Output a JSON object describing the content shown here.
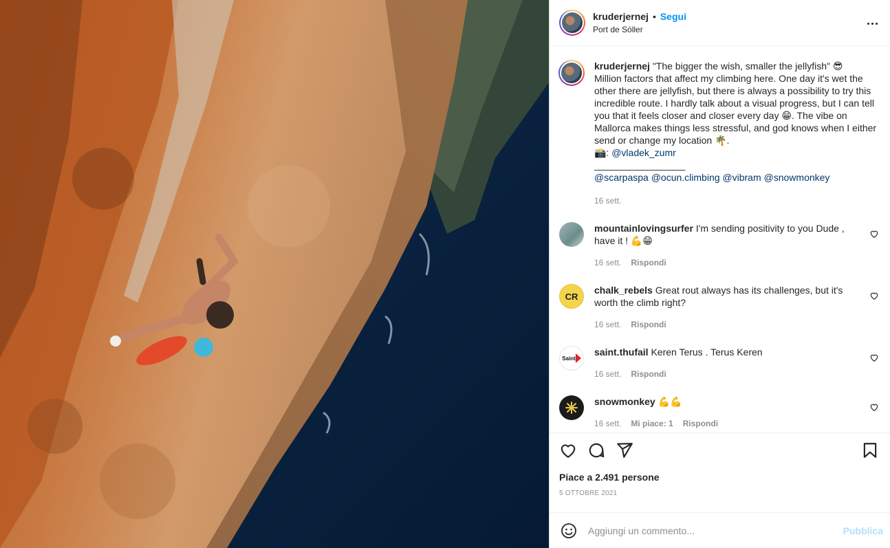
{
  "header": {
    "username": "kruderjernej",
    "separator": "•",
    "follow_label": "Segui",
    "location": "Port de Sóller",
    "more_icon": "more-horizontal-icon"
  },
  "caption": {
    "username": "kruderjernej",
    "lines": [
      "\"The bigger the wish, smaller the jellyfish\" 😎",
      "Million factors that affect my climbing here. One day it's wet the other there are jellyfish, but there is always a possibility to try this incredible route. I hardly talk about a visual progress, but I can tell you that it feels closer and closer every day 😁. The vibe on Mallorca makes things less stressful, and god knows when I either send or change my location 🌴.",
      "📸: "
    ],
    "photo_credit": "@vladek_zumr",
    "divider": "_________________",
    "tags": [
      "@scarpaspa",
      "@ocun.climbing",
      "@vibram",
      "@snowmonkey"
    ],
    "time": "16 sett."
  },
  "comments": [
    {
      "username": "mountainlovingsurfer",
      "text": "I'm sending positivity to you Dude , have it ! 💪😁",
      "time": "16 sett.",
      "likes": "",
      "reply": "Rispondi"
    },
    {
      "username": "chalk_rebels",
      "text": "Great rout always has its challenges, but it's worth the climb right?",
      "time": "16 sett.",
      "likes": "",
      "reply": "Rispondi",
      "avatar_text": "CR"
    },
    {
      "username": "saint.thufail",
      "text": "Keren Terus . Terus Keren",
      "time": "16 sett.",
      "likes": "",
      "reply": "Rispondi",
      "avatar_text": "Saint"
    },
    {
      "username": "snowmonkey",
      "text": "💪💪",
      "time": "16 sett.",
      "likes": "Mi piace: 1",
      "reply": "Rispondi"
    }
  ],
  "actions": {
    "likes_text": "Piace a 2.491 persone",
    "date": "5 OTTOBRE 2021"
  },
  "add_comment": {
    "placeholder": "Aggiungi un commento...",
    "publish_label": "Pubblica"
  },
  "colors": {
    "link": "#0095f6",
    "mention": "#00376b",
    "muted": "#8e8e8e",
    "publish_disabled": "#b2dffc"
  }
}
